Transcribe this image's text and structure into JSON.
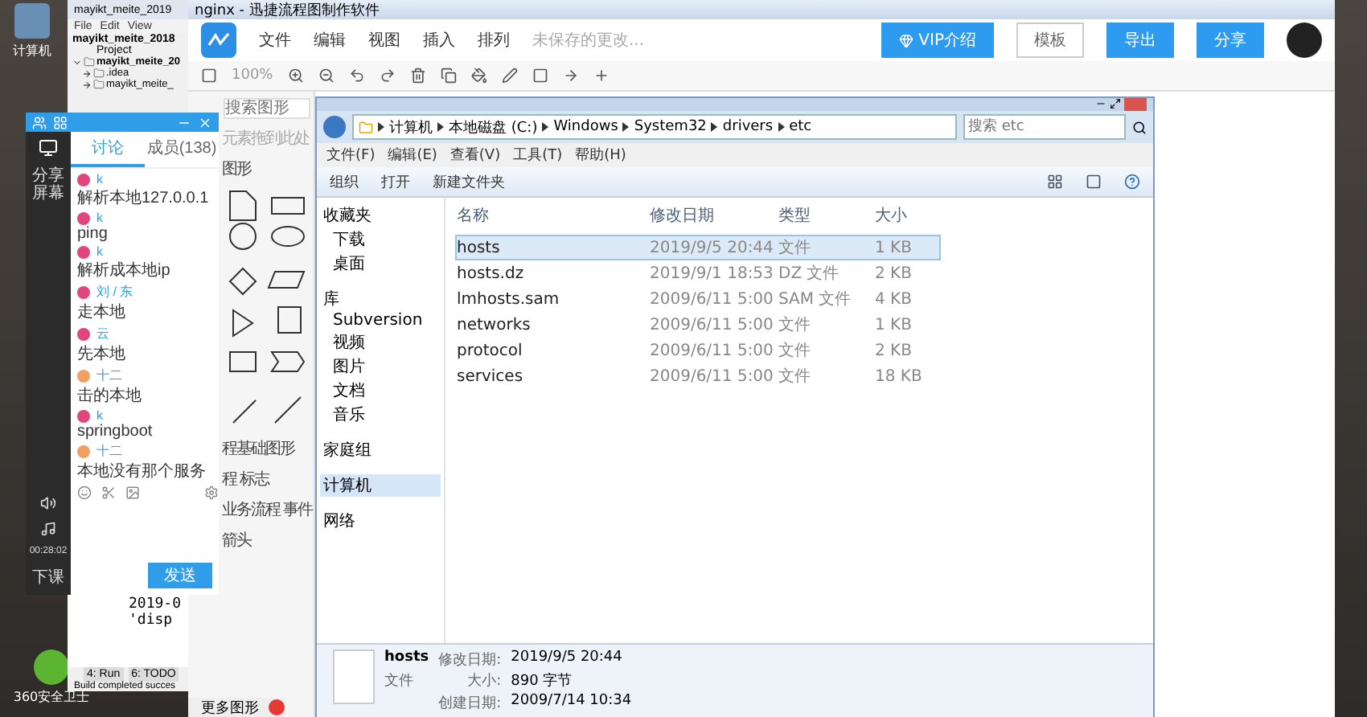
{
  "desktop": {
    "icons": [
      {
        "label": "计算机"
      },
      {
        "label": "360安全卫士"
      }
    ]
  },
  "ide": {
    "title": "mayikt_meite_2019",
    "menu": [
      "File",
      "Edit",
      "View"
    ],
    "project": "mayikt_meite_2018",
    "panel": "Project",
    "tree": [
      {
        "label": "mayikt_meite_20",
        "expanded": true,
        "children": [
          {
            "label": ".idea",
            "expanded": false
          },
          {
            "label": "mayikt_meite_",
            "expanded": false
          }
        ]
      }
    ],
    "console": [
      "2019-0",
      "'disp"
    ],
    "tabs": [
      "4: Run",
      "6: TODO"
    ],
    "status": "Build completed succes"
  },
  "flowchart": {
    "title": "nginx - 迅捷流程图制作软件",
    "menu": [
      "文件",
      "编辑",
      "视图",
      "插入",
      "排列"
    ],
    "unsaved": "未保存的更改...",
    "zoom": "100%",
    "vip": "VIP介绍",
    "buttons": [
      {
        "label": "模板",
        "kind": "plain"
      },
      {
        "label": "导出",
        "kind": "primary"
      },
      {
        "label": "分享",
        "kind": "primary"
      }
    ],
    "search_placeholder": "搜索图形",
    "hint": "元素拖到此处",
    "sections": [
      "图形",
      "程基础图形",
      "程 标志",
      "业务流程 事件",
      "箭头"
    ],
    "footer": "更多图形"
  },
  "chat": {
    "tabs": [
      {
        "label": "讨论",
        "selected": true
      },
      {
        "label": "成员(138)",
        "selected": false
      }
    ],
    "share": "分享屏幕",
    "timer": "00:28:02",
    "leave": "下课",
    "messages": [
      {
        "sender": "k",
        "text": "解析本地127.0.0.1",
        "color": "#e0457b"
      },
      {
        "sender": "k",
        "text": "ping",
        "color": "#e0457b"
      },
      {
        "sender": "k",
        "text": "解析成本地ip",
        "color": "#e0457b"
      },
      {
        "sender": "刘 / 东",
        "text": "走本地",
        "color": "#e0457b"
      },
      {
        "sender": "云",
        "text": "先本地",
        "color": "#e0457b"
      },
      {
        "sender": "十二",
        "text": "击的本地",
        "color": "#f0a060"
      },
      {
        "sender": "k",
        "text": "springboot",
        "color": "#e0457b"
      },
      {
        "sender": "十二",
        "text": "本地没有那个服务",
        "color": "#f0a060"
      }
    ],
    "send": "发送"
  },
  "explorer": {
    "path": [
      "计算机",
      "本地磁盘 (C:)",
      "Windows",
      "System32",
      "drivers",
      "etc"
    ],
    "search_placeholder": "搜索 etc",
    "menu": [
      "文件(F)",
      "编辑(E)",
      "查看(V)",
      "工具(T)",
      "帮助(H)"
    ],
    "toolbar": [
      "组织",
      "打开",
      "新建文件夹"
    ],
    "nav": [
      {
        "label": "收藏夹",
        "selected": false,
        "children": [
          {
            "label": "下载",
            "selected": false
          },
          {
            "label": "桌面",
            "selected": false
          }
        ]
      },
      {
        "label": "库",
        "selected": false,
        "children": [
          {
            "label": "Subversion",
            "selected": false
          },
          {
            "label": "视频",
            "selected": false
          },
          {
            "label": "图片",
            "selected": false
          },
          {
            "label": "文档",
            "selected": false
          },
          {
            "label": "音乐",
            "selected": false
          }
        ]
      },
      {
        "label": "家庭组",
        "selected": false
      },
      {
        "label": "计算机",
        "selected": true
      },
      {
        "label": "网络",
        "selected": false
      }
    ],
    "columns": [
      "名称",
      "修改日期",
      "类型",
      "大小"
    ],
    "rows": [
      {
        "cells": [
          "hosts",
          "2019/9/5 20:44",
          "文件",
          "1 KB"
        ],
        "selected": true
      },
      {
        "cells": [
          "hosts.dz",
          "2019/9/1 18:53",
          "DZ 文件",
          "2 KB"
        ],
        "selected": false
      },
      {
        "cells": [
          "lmhosts.sam",
          "2009/6/11 5:00",
          "SAM 文件",
          "4 KB"
        ],
        "selected": false
      },
      {
        "cells": [
          "networks",
          "2009/6/11 5:00",
          "文件",
          "1 KB"
        ],
        "selected": false
      },
      {
        "cells": [
          "protocol",
          "2009/6/11 5:00",
          "文件",
          "2 KB"
        ],
        "selected": false
      },
      {
        "cells": [
          "services",
          "2009/6/11 5:00",
          "文件",
          "18 KB"
        ],
        "selected": false
      }
    ],
    "details": {
      "name": "hosts",
      "type": "文件",
      "fields": [
        {
          "label": "修改日期:",
          "value": "2019/9/5 20:44"
        },
        {
          "label": "大小:",
          "value": "890 字节"
        },
        {
          "label": "创建日期:",
          "value": "2009/7/14 10:34"
        }
      ]
    }
  }
}
